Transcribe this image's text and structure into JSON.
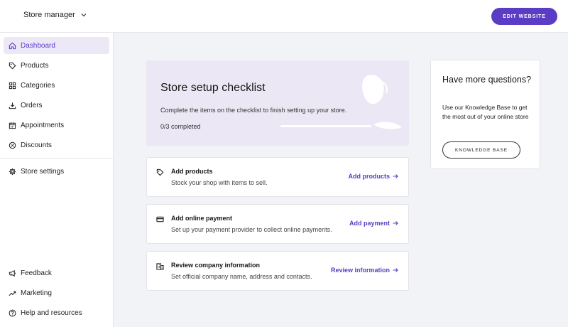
{
  "header": {
    "store_selector": "Store manager",
    "edit_button": "EDIT WEBSITE"
  },
  "sidebar": {
    "items": [
      {
        "label": "Dashboard",
        "icon": "home-icon",
        "active": true
      },
      {
        "label": "Products",
        "icon": "tag-icon"
      },
      {
        "label": "Categories",
        "icon": "grid-icon"
      },
      {
        "label": "Orders",
        "icon": "download-icon"
      },
      {
        "label": "Appointments",
        "icon": "calendar-icon"
      },
      {
        "label": "Discounts",
        "icon": "discount-icon"
      },
      {
        "label": "Store settings",
        "icon": "gear-icon"
      }
    ],
    "bottom_items": [
      {
        "label": "Feedback",
        "icon": "megaphone-icon"
      },
      {
        "label": "Marketing",
        "icon": "trending-icon"
      },
      {
        "label": "Help and resources",
        "icon": "help-icon"
      }
    ]
  },
  "checklist": {
    "title": "Store setup checklist",
    "description": "Complete the items on the checklist to finish setting up your store.",
    "progress_text": "0/3 completed",
    "progress_fraction": 0,
    "colors": {
      "accent": "#5b3cc4",
      "banner_bg": "#ece7f4"
    }
  },
  "tasks": [
    {
      "title": "Add products",
      "description": "Stock your shop with items to sell.",
      "link": "Add products",
      "icon": "tag-icon"
    },
    {
      "title": "Add online payment",
      "description": "Set up your payment provider to collect online payments.",
      "link": "Add payment",
      "icon": "credit-card-icon"
    },
    {
      "title": "Review company information",
      "description": "Set official company name, address and contacts.",
      "link": "Review information",
      "icon": "building-icon"
    }
  ],
  "help": {
    "title": "Have more questions?",
    "body": "Use our Knowledge Base to get the most out of your online store",
    "button": "KNOWLEDGE BASE"
  }
}
